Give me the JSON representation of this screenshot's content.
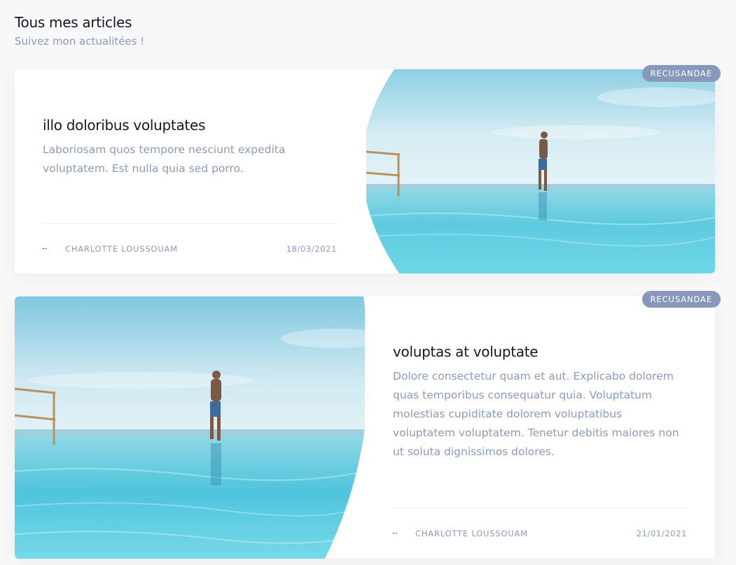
{
  "header": {
    "title": "Tous mes articles",
    "subtitle": "Suivez mon actualitées !"
  },
  "articles": [
    {
      "title": "illo doloribus voluptates",
      "excerpt": "Laboriosam quos tempore nesciunt expedita voluptatem. Est nulla quia sed porro.",
      "author": "CHARLOTTE LOUSSOUAM",
      "date": "18/03/2021",
      "badge": "RECUSANDAE",
      "image_layout": "right"
    },
    {
      "title": "voluptas at voluptate",
      "excerpt": "Dolore consectetur quam et aut. Explicabo dolorem quas temporibus consequatur quia. Voluptatum molestias cupiditate dolorem voluptatibus voluptatem voluptatem. Tenetur debitis maiores non ut soluta dignissimos dolores.",
      "author": "CHARLOTTE LOUSSOUAM",
      "date": "21/01/2021",
      "badge": "RECUSANDAE",
      "image_layout": "left"
    }
  ],
  "colors": {
    "accent": "#8898bb",
    "muted_text": "#8a9bbd",
    "heading": "#15172b",
    "sky": "#bfe3ee",
    "water": "#4fc6dc"
  }
}
